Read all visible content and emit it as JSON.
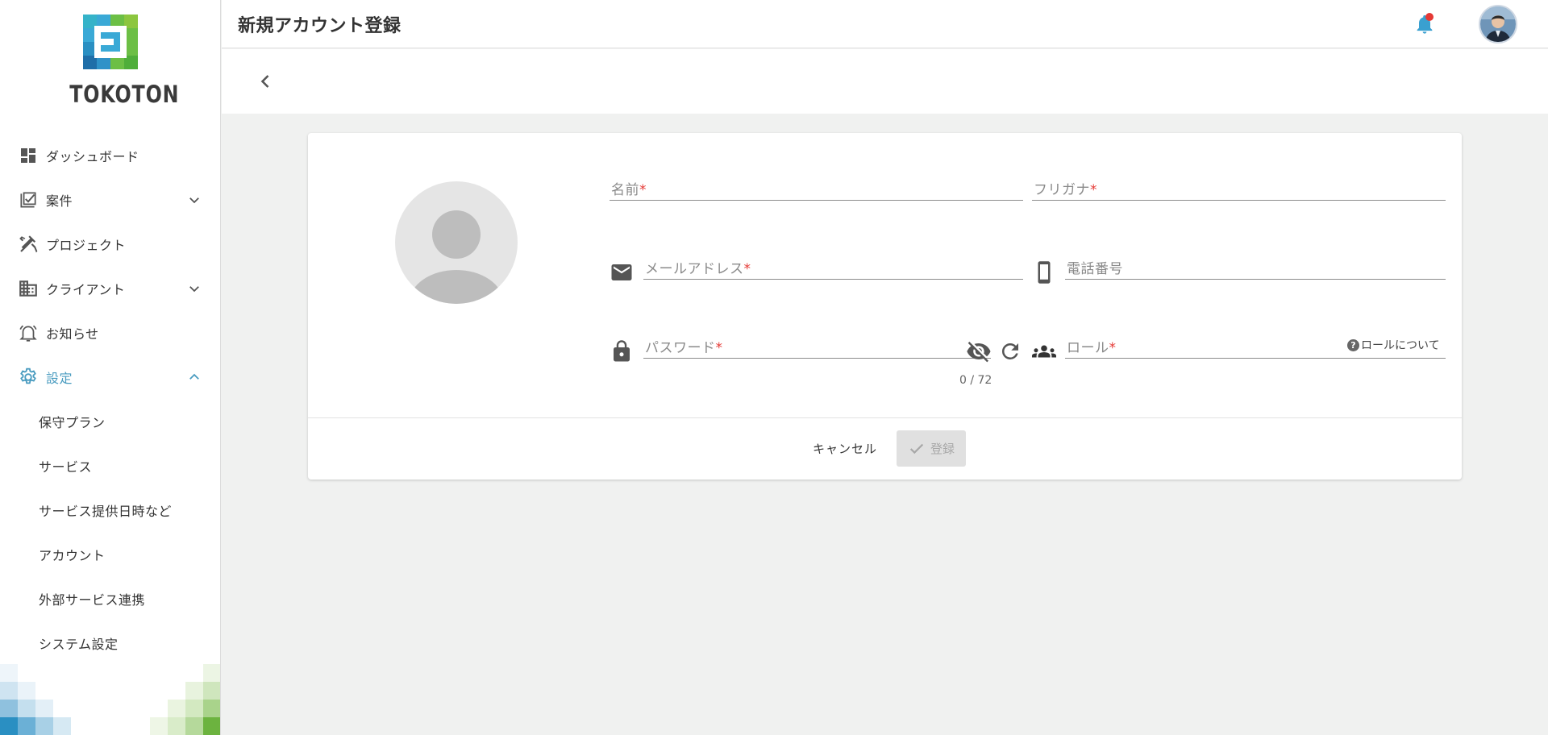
{
  "app": {
    "logo_text": "TOKOTON",
    "brand_blue": "#3aa9d6",
    "brand_green": "#7bc043"
  },
  "sidebar": {
    "items": [
      {
        "label": "ダッシュボード",
        "icon": "dashboard-icon"
      },
      {
        "label": "案件",
        "icon": "task-checklist-icon",
        "expandable": true
      },
      {
        "label": "プロジェクト",
        "icon": "tools-icon"
      },
      {
        "label": "クライアント",
        "icon": "building-icon",
        "expandable": true
      },
      {
        "label": "お知らせ",
        "icon": "notification-bell-icon"
      },
      {
        "label": "設定",
        "icon": "gear-icon",
        "expanded": true,
        "active": true
      }
    ],
    "settings_subitems": [
      {
        "label": "保守プラン"
      },
      {
        "label": "サービス"
      },
      {
        "label": "サービス提供日時など"
      },
      {
        "label": "アカウント"
      },
      {
        "label": "外部サービス連携"
      },
      {
        "label": "システム設定"
      }
    ],
    "active_color": "#4a9cc0"
  },
  "header": {
    "title": "新規アカウント登録",
    "notification_icon": "bell-icon",
    "notification_dot_color": "#e53935"
  },
  "form": {
    "name": {
      "placeholder": "名前",
      "required_mark": "*"
    },
    "furigana": {
      "placeholder": "フリガナ",
      "required_mark": "*"
    },
    "email": {
      "placeholder": "メールアドレス",
      "required_mark": "*",
      "icon": "mail-icon"
    },
    "phone": {
      "placeholder": "電話番号",
      "icon": "smartphone-icon"
    },
    "password": {
      "placeholder": "パスワード",
      "required_mark": "*",
      "icon": "lock-icon",
      "counter": "0 / 72"
    },
    "role": {
      "placeholder": "ロール",
      "required_mark": "*",
      "icon": "group-icon",
      "help_label": "ロールについて"
    },
    "cancel_label": "キャンセル",
    "submit_label": "登録"
  }
}
